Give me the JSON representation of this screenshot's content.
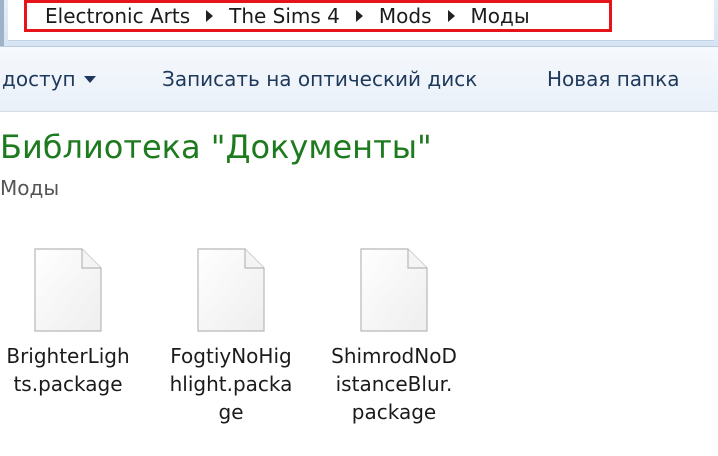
{
  "address_bar": {
    "breadcrumbs": [
      "Electronic Arts",
      "The Sims 4",
      "Mods",
      "Моды"
    ]
  },
  "toolbar": {
    "share_label": "доступ",
    "burn_label": "Записать на оптический диск",
    "new_folder_label": "Новая папка"
  },
  "library": {
    "title": "Библиотека \"Документы\"",
    "subtitle": "Моды"
  },
  "files": [
    {
      "name": "BrighterLights.package"
    },
    {
      "name": "FogtiyNoHighlight.package"
    },
    {
      "name": "ShimrodNoDistanceBlur.package"
    }
  ],
  "colors": {
    "highlight_border": "#e5141b",
    "library_title": "#1e7a1e",
    "toolbar_text": "#1e395b"
  }
}
